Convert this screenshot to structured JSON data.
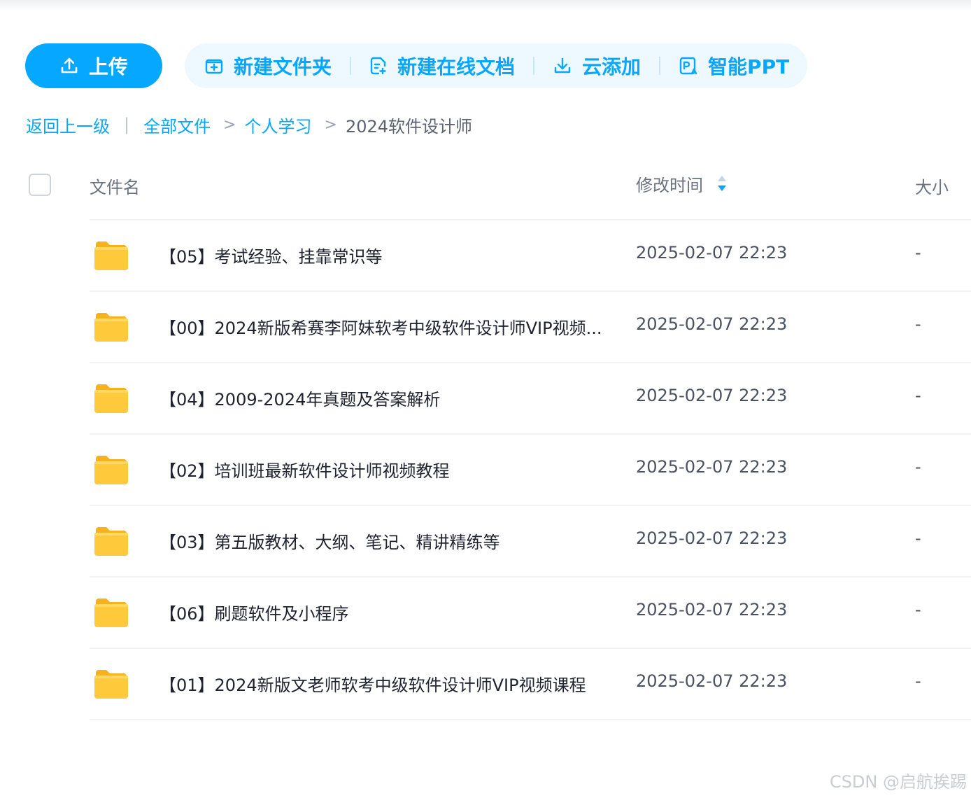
{
  "toolbar": {
    "upload_label": "上传",
    "new_folder_label": "新建文件夹",
    "new_doc_label": "新建在线文档",
    "cloud_add_label": "云添加",
    "smart_ppt_label": "智能PPT"
  },
  "breadcrumb": {
    "back_label": "返回上一级",
    "separator": "|",
    "arrow": ">",
    "items": [
      "全部文件",
      "个人学习"
    ],
    "current": "2024软件设计师"
  },
  "table": {
    "headers": {
      "name": "文件名",
      "modified": "修改时间",
      "size": "大小"
    },
    "rows": [
      {
        "name": "【05】考试经验、挂靠常识等",
        "modified": "2025-02-07 22:23",
        "size": "-"
      },
      {
        "name": "【00】2024新版希赛李阿妹软考中级软件设计师VIP视频...",
        "modified": "2025-02-07 22:23",
        "size": "-"
      },
      {
        "name": "【04】2009-2024年真题及答案解析",
        "modified": "2025-02-07 22:23",
        "size": "-"
      },
      {
        "name": "【02】培训班最新软件设计师视频教程",
        "modified": "2025-02-07 22:23",
        "size": "-"
      },
      {
        "name": "【03】第五版教材、大纲、笔记、精讲精练等",
        "modified": "2025-02-07 22:23",
        "size": "-"
      },
      {
        "name": "【06】刷题软件及小程序",
        "modified": "2025-02-07 22:23",
        "size": "-"
      },
      {
        "name": "【01】2024新版文老师软考中级软件设计师VIP视频课程",
        "modified": "2025-02-07 22:23",
        "size": "-"
      }
    ]
  },
  "watermark": "CSDN @启航挨踢",
  "colors": {
    "accent": "#06a7ff",
    "action_bg": "#eef8ff",
    "folder": "#ffc53d"
  }
}
